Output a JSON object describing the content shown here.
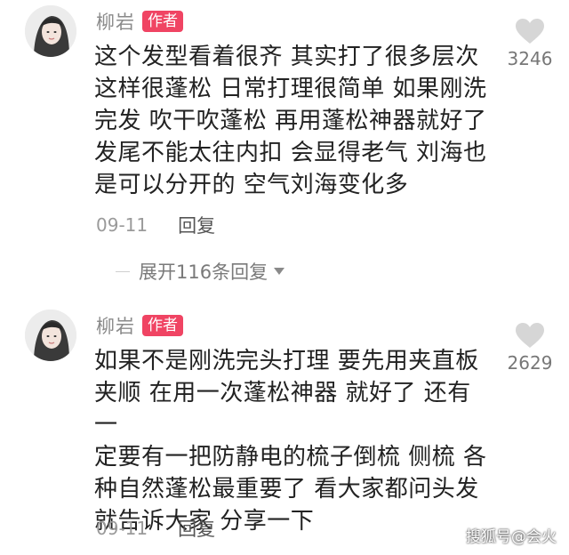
{
  "comments": [
    {
      "author": "柳岩",
      "badge": "作者",
      "text": "这个发型看着很齐 其实打了很多层次\n这样很蓬松 日常打理很简单 如果刚洗\n完发 吹干吹蓬松 再用蓬松神器就好了\n发尾不能太往内扣 会显得老气 刘海也\n是可以分开的 空气刘海变化多",
      "date": "09-11",
      "reply_label": "回复",
      "likes": "3246",
      "like_icon": "heart-icon"
    },
    {
      "author": "柳岩",
      "badge": "作者",
      "text": "如果不是刚洗完头打理 要先用夹直板\n夹顺 在用一次蓬松神器 就好了 还有一\n定要有一把防静电的梳子倒梳 侧梳 各\n种自然蓬松最重要了 看大家都问头发\n就告诉大家 分享一下",
      "date": "09-11",
      "reply_label": "回复",
      "likes": "2629",
      "like_icon": "heart-icon"
    }
  ],
  "expand_replies": {
    "label": "展开116条回复",
    "icon": "caret-down-icon"
  },
  "watermark": "搜狐号@会火",
  "colors": {
    "badge": "#f04463",
    "heart": "#d6d6d6"
  }
}
